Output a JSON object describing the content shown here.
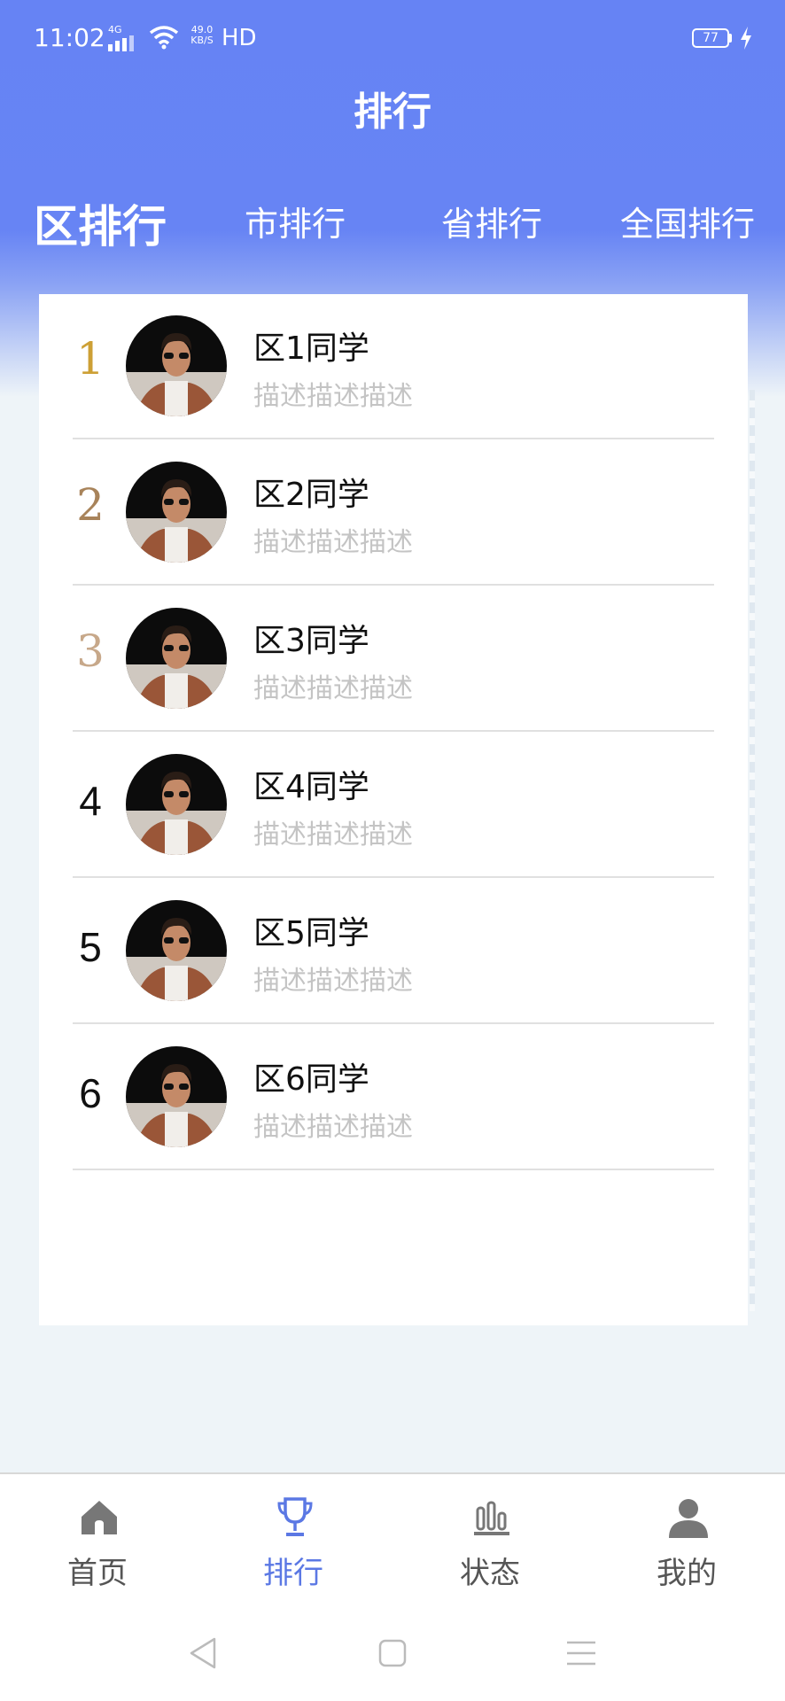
{
  "status_bar": {
    "time": "11:02",
    "network": "4G",
    "speed_top": "49.0",
    "speed_unit": "KB/S",
    "hd": "HD",
    "battery": "77"
  },
  "header": {
    "title": "排行"
  },
  "tabs": [
    {
      "label": "区排行",
      "active": true
    },
    {
      "label": "市排行",
      "active": false
    },
    {
      "label": "省排行",
      "active": false
    },
    {
      "label": "全国排行",
      "active": false
    }
  ],
  "ranking": [
    {
      "rank": "1",
      "name": "区1同学",
      "desc": "描述描述描述"
    },
    {
      "rank": "2",
      "name": "区2同学",
      "desc": "描述描述描述"
    },
    {
      "rank": "3",
      "name": "区3同学",
      "desc": "描述描述描述"
    },
    {
      "rank": "4",
      "name": "区4同学",
      "desc": "描述描述描述"
    },
    {
      "rank": "5",
      "name": "区5同学",
      "desc": "描述描述描述"
    },
    {
      "rank": "6",
      "name": "区6同学",
      "desc": "描述描述描述"
    }
  ],
  "bottom_nav": [
    {
      "label": "首页",
      "icon": "home-icon",
      "active": false
    },
    {
      "label": "排行",
      "icon": "trophy-icon",
      "active": true
    },
    {
      "label": "状态",
      "icon": "bar-chart-icon",
      "active": false
    },
    {
      "label": "我的",
      "icon": "user-icon",
      "active": false
    }
  ],
  "colors": {
    "header_blue": "#6784f4",
    "active_nav": "#5b78e4",
    "gold": "#cda035",
    "silver": "#a8835a",
    "bronze": "#c7a88a"
  }
}
